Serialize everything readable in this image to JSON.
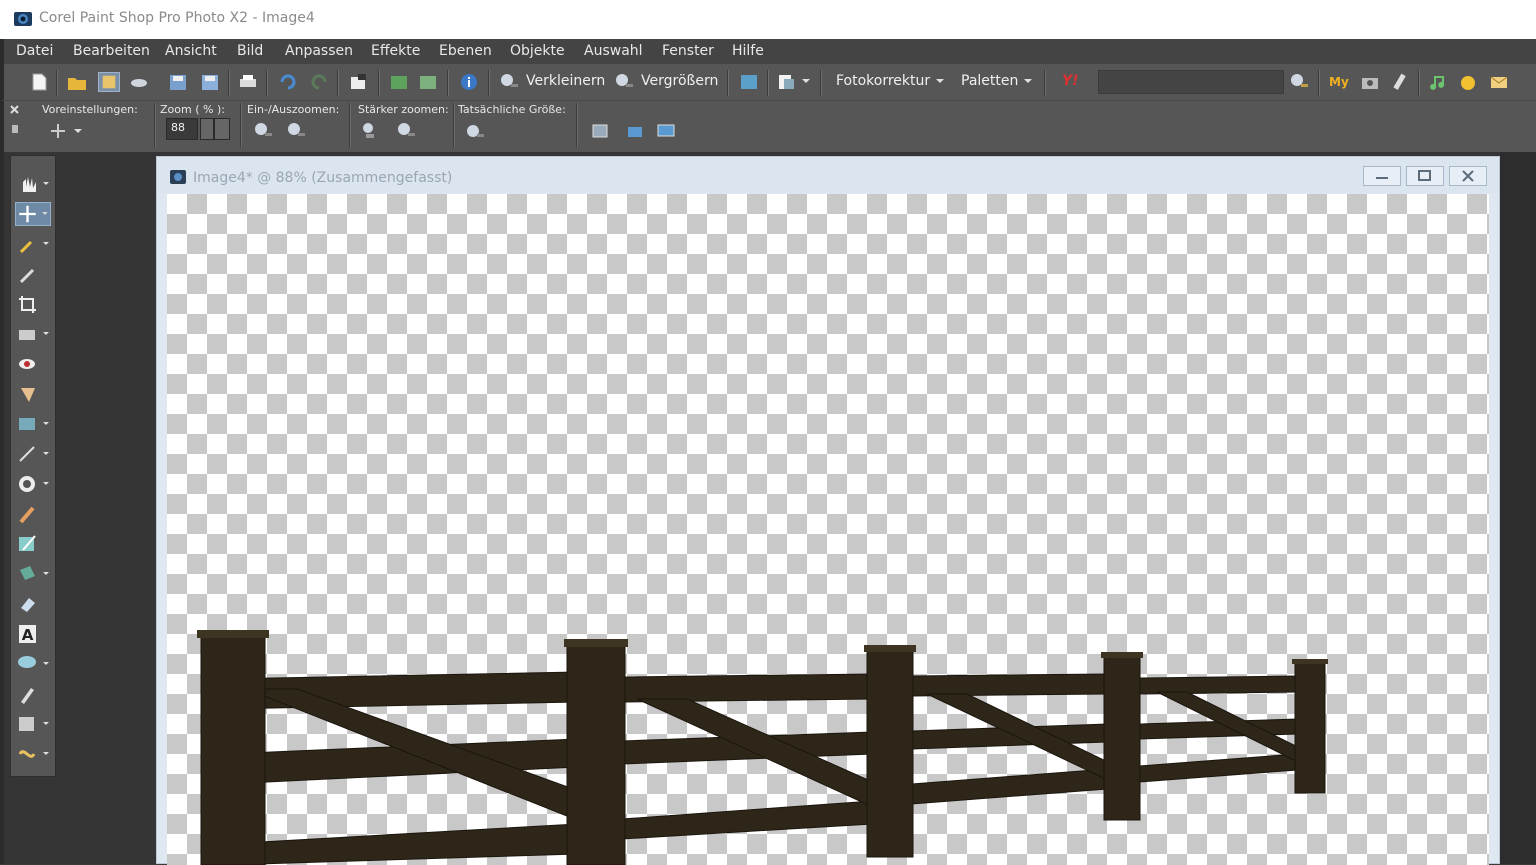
{
  "window": {
    "title": "Corel Paint Shop Pro Photo X2 - Image4"
  },
  "menu": [
    {
      "label": "Datei"
    },
    {
      "label": "Bearbeiten"
    },
    {
      "label": "Ansicht"
    },
    {
      "label": "Bild"
    },
    {
      "label": "Anpassen"
    },
    {
      "label": "Effekte"
    },
    {
      "label": "Ebenen"
    },
    {
      "label": "Objekte"
    },
    {
      "label": "Auswahl"
    },
    {
      "label": "Fenster"
    },
    {
      "label": "Hilfe"
    }
  ],
  "toolbar": {
    "zoom_out_label": "Verkleinern",
    "zoom_in_label": "Vergrößern",
    "photo_fix_label": "Fotokorrektur",
    "palettes_label": "Paletten",
    "yahoo_label": "Y!",
    "my_label": "My"
  },
  "options": {
    "presets_label": "Voreinstellungen:",
    "zoom_label": "Zoom ( % ):",
    "zoom_value": "88",
    "zoom_inout_label": "Ein-/Auszoomen:",
    "zoom_more_label": "Stärker zoomen:",
    "actual_size_label": "Tatsächliche Größe:"
  },
  "document": {
    "title": "Image4* @  88% (Zusammengefasst)"
  },
  "colors": {
    "menubar": "#444444",
    "toolbar": "#565656",
    "doc_title": "#dbe5ef",
    "fence": "#2e2618"
  }
}
